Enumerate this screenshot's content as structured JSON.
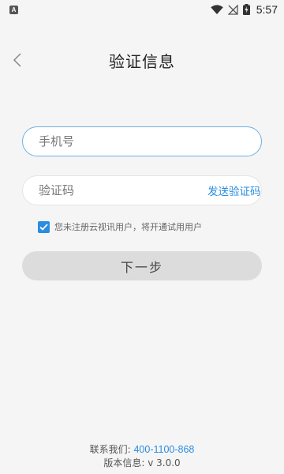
{
  "status_bar": {
    "app_notification_letter": "A",
    "time": "5:57",
    "icons": [
      "wifi-icon",
      "no-signal-icon",
      "battery-charging-icon"
    ]
  },
  "header": {
    "title": "验证信息",
    "back_icon": "chevron-left-icon"
  },
  "form": {
    "phone_placeholder": "手机号",
    "phone_value": "",
    "code_placeholder": "验证码",
    "code_value": "",
    "send_code_label": "发送验证码",
    "agree_checked": true,
    "agree_text": "您未注册云视讯用户，将开通试用用户",
    "next_label": "下一步"
  },
  "footer": {
    "contact_label": "联系我们: ",
    "contact_phone": "400-1100-868",
    "version_text": "版本信息: v 3.0.0"
  },
  "colors": {
    "accent": "#2a8de0",
    "input_focus_border": "#6fb0e4",
    "button_disabled": "#dcdcdc",
    "background": "#f5f5f5"
  }
}
